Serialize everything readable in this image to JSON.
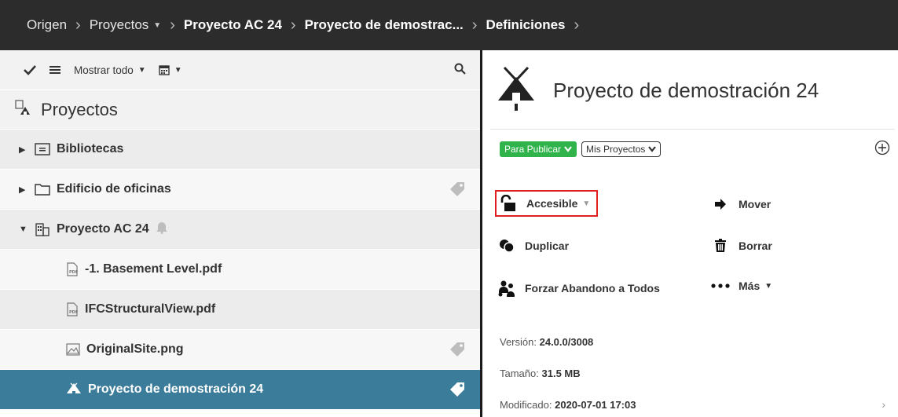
{
  "breadcrumb": {
    "items": [
      "Origen",
      "Proyectos",
      "Proyecto AC 24",
      "Proyecto de demostrac...",
      "Definiciones"
    ]
  },
  "toolbar": {
    "show_all_label": "Mostrar todo"
  },
  "tree": {
    "header": "Proyectos",
    "items": [
      {
        "label": "Bibliotecas"
      },
      {
        "label": "Edificio de oficinas"
      },
      {
        "label": "Proyecto AC 24"
      },
      {
        "label": "-1. Basement Level.pdf"
      },
      {
        "label": "IFCStructuralView.pdf"
      },
      {
        "label": "OriginalSite.png"
      },
      {
        "label": "Proyecto de demostración 24"
      }
    ]
  },
  "detail": {
    "title": "Proyecto de demostración 24",
    "tag_status": "Para Publicar",
    "tag_filter": "Mis Proyectos",
    "actions": {
      "accessible": "Accesible",
      "move": "Mover",
      "duplicate": "Duplicar",
      "delete": "Borrar",
      "force_abandon": "Forzar Abandono a Todos",
      "more": "Más"
    },
    "meta": {
      "version_label": "Versión:",
      "version_value": "24.0.0/3008",
      "size_label": "Tamaño:",
      "size_value": "31.5 MB",
      "modified_label": "Modificado:",
      "modified_value": "2020-07-01 17:03"
    }
  },
  "colors": {
    "topbar": "#2c2c2c",
    "selected_row": "#3b7c9a",
    "status_green": "#2fb34a",
    "highlight_red": "#e02020"
  }
}
